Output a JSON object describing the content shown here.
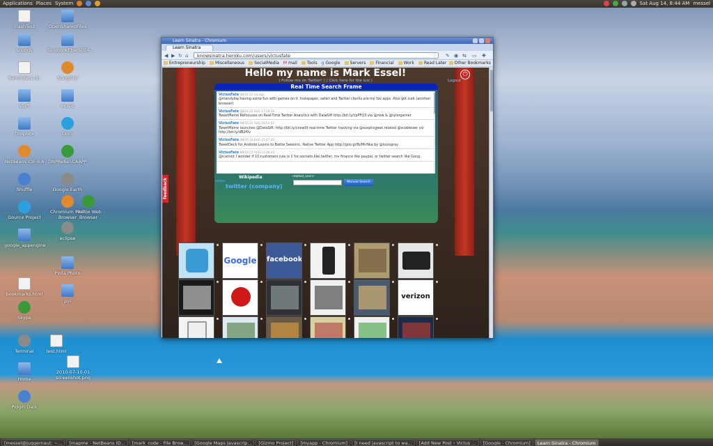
{
  "topbar": {
    "menus": [
      "Applications",
      "Places",
      "System"
    ],
    "datetime": "Sat Aug 14,  8:44 AM",
    "user": "messel"
  },
  "desktop": {
    "icons": [
      {
        "label": "FlashTest",
        "type": "file"
      },
      {
        "label": "OpenSharedFiles",
        "type": "folder"
      },
      {
        "label": "sounds",
        "type": "folder"
      },
      {
        "label": "facebookfibers004-...",
        "type": "folder"
      },
      {
        "label": "Reminders.txt",
        "type": "file"
      },
      {
        "label": "Songbird",
        "type": "app"
      },
      {
        "label": "stuff",
        "type": "folder"
      },
      {
        "label": "music",
        "type": "folder"
      },
      {
        "label": "Dropbox",
        "type": "folder"
      },
      {
        "label": "Docs",
        "type": "app"
      },
      {
        "label": "NetBeans IDE 6.8",
        "type": "app"
      },
      {
        "label": "DNPRebel.CAAPP",
        "type": "app"
      },
      {
        "label": "Shuffle",
        "type": "app"
      },
      {
        "label": "Google Earth",
        "type": "app"
      },
      {
        "label": "Gource Project",
        "type": "app"
      },
      {
        "label": "Chromium Web Browser",
        "type": "app"
      },
      {
        "label": "Firefox Web Browser",
        "type": "app"
      },
      {
        "label": "google_appengine",
        "type": "folder"
      },
      {
        "label": "eclipse",
        "type": "app"
      },
      {
        "label": "Pinta Photo",
        "type": "folder"
      },
      {
        "label": "bookmarks.html",
        "type": "file"
      },
      {
        "label": "Skype",
        "type": "app"
      },
      {
        "label": "pyl",
        "type": "folder"
      },
      {
        "label": "Terminal",
        "type": "app"
      },
      {
        "label": "test.html",
        "type": "file"
      },
      {
        "label": "Home",
        "type": "folder"
      },
      {
        "label": "2010-07-10-01 screenshot.png",
        "type": "file"
      },
      {
        "label": "Pidgin Dark",
        "type": "app"
      }
    ]
  },
  "browser": {
    "window_title": "Learn Sinatra - Chromium",
    "tab": "Learn Sinatra",
    "url": "knowsinatra.heroku.com/users/victusfate",
    "bookmarks": [
      "Entrepreneurship",
      "Miscellaneous",
      "SocialMedia",
      "mail",
      "Tools",
      "Google",
      "Servers",
      "Financial",
      "Work",
      "Read Later"
    ],
    "other_bookmarks": "Other Bookmarks"
  },
  "page": {
    "hello": "Hello my name is Mark Essel!",
    "subtitle": "( Follow me on Twitter! ) ( Click here for the lulz )",
    "logout": "Logout",
    "frame_title": "Real Time Search Frame",
    "tweets": [
      {
        "user": "VictusFate",
        "time": "08/16 22:44 ago",
        "text": "@mandybw having some fun with games on it. Instapaper, safari and Twitter clients are my fav apps. Also got icab (another browser)"
      },
      {
        "user": "VictusFate",
        "time": "08/16 22 AUG 17:18:18",
        "text": "TweetMeme Refocuses on Real-Time Twitter Analytics with DataSift http://bit.ly/cpPFQ3 via @new & @tylergarner"
      },
      {
        "user": "VictusFate",
        "time": "08/16 22 AUG 16:53:42",
        "text": "TweetMeme launches @DataSift: http://bit.ly/cnew0t real-time Twitter tracking via @scepticgeek related @scobleizer viz http://bit.ly/dB2f0v"
      },
      {
        "user": "VictusFate",
        "time": "08/16 22 AUG 15:47:20",
        "text": "TweetDeck for Android Looms to Battle Seesmic, Native Twitter App http://goo.gl/fb/MnNka by @louisgray"
      },
      {
        "user": "VictusFate",
        "time": "08/16 22 AUG 13:36:33",
        "text": "@icamint I wonder if 10 customers rule is 1 for socnets like twitter, mv finance like paypal, or twitter search like Gong."
      }
    ],
    "wikipedia": "Wikipedia",
    "related_users": "related_users:",
    "twitter_link": "twitter",
    "twitter_company": "twitter (company)",
    "search_button": "Manual Search",
    "feedback": "feedback"
  },
  "tiles": [
    {
      "label": "",
      "bg": "#bfe2f4",
      "fg": "#3b9bd6",
      "shape": "bird"
    },
    {
      "label": "Google",
      "bg": "#ffffff",
      "fg": "#3a6fd8",
      "shape": "text"
    },
    {
      "label": "facebook",
      "bg": "#3b5998",
      "fg": "#ffffff",
      "shape": "text"
    },
    {
      "label": "",
      "bg": "#f2f2f2",
      "fg": "#222222",
      "shape": "phone"
    },
    {
      "label": "",
      "bg": "#b09a70",
      "fg": "#6b5433",
      "shape": "photo"
    },
    {
      "label": "",
      "bg": "#e7e7e7",
      "fg": "#222222",
      "shape": "tablet"
    },
    {
      "label": "",
      "bg": "#1a1a1a",
      "fg": "#dddddd",
      "shape": "photo"
    },
    {
      "label": "",
      "bg": "#ffffff",
      "fg": "#d01818",
      "shape": "apple"
    },
    {
      "label": "",
      "bg": "#303036",
      "fg": "#9aa",
      "shape": "keys"
    },
    {
      "label": "",
      "bg": "#f0f0f0",
      "fg": "#333",
      "shape": "rockets"
    },
    {
      "label": "",
      "bg": "#4a5a70",
      "fg": "#e8c070",
      "shape": "photo"
    },
    {
      "label": "verizon",
      "bg": "#ffffff",
      "fg": "#111111",
      "shape": "text"
    },
    {
      "label": "",
      "bg": "#f3f3f3",
      "fg": "#777",
      "shape": "kindle"
    },
    {
      "label": "",
      "bg": "#dfe8f0",
      "fg": "#4a7a3a",
      "shape": "screen"
    },
    {
      "label": "",
      "bg": "#6a5a46",
      "fg": "#e0a040",
      "shape": "photo"
    },
    {
      "label": "",
      "bg": "#d8d0a0",
      "fg": "#b04040",
      "shape": "map"
    },
    {
      "label": "",
      "bg": "#f0f0f0",
      "fg": "#40a040",
      "shape": "map"
    },
    {
      "label": "",
      "bg": "#1d2a48",
      "fg": "#c04030",
      "shape": "bridge"
    }
  ],
  "taskbar": [
    {
      "label": "[messel@juggernaut: ~...",
      "active": false
    },
    {
      "label": "[mapme - NetBeans ID...",
      "active": false
    },
    {
      "label": "[mark_code - File Brow...",
      "active": false
    },
    {
      "label": "[Google Maps Javascrip...",
      "active": false
    },
    {
      "label": "[Gizmo Project]",
      "active": false
    },
    {
      "label": "[myapp - Chromium]",
      "active": false
    },
    {
      "label": "[I need javascript to wa...",
      "active": false
    },
    {
      "label": "[Add New Post ‹ Victus ...",
      "active": false
    },
    {
      "label": "[Google - Chromium]",
      "active": false
    },
    {
      "label": "Learn Sinatra - Chromium",
      "active": true
    }
  ]
}
